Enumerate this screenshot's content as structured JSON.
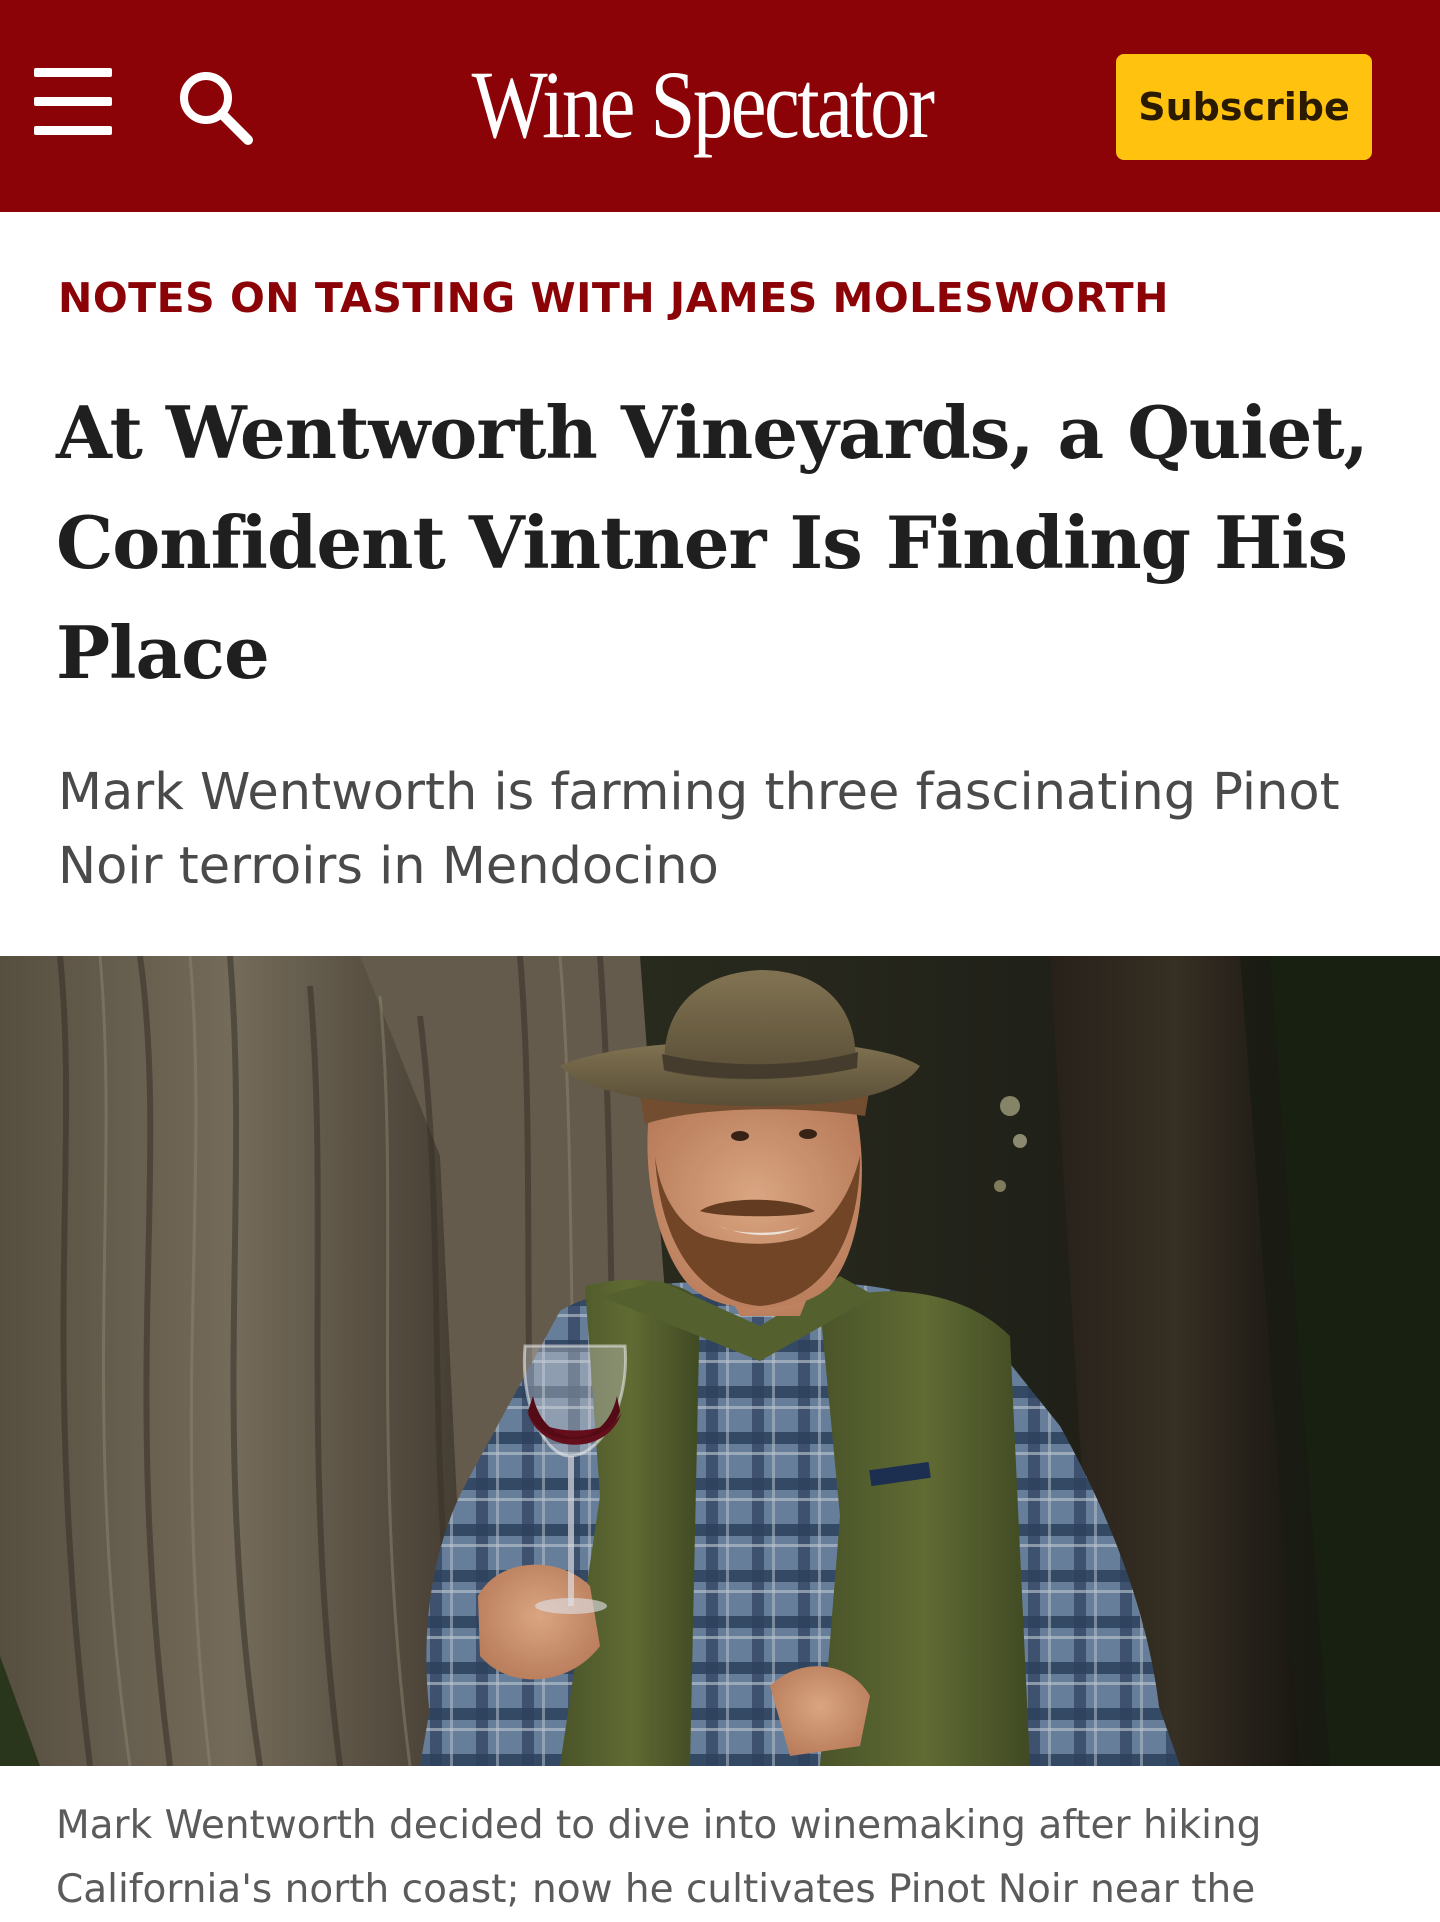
{
  "header": {
    "menu_icon": "hamburger-menu-icon",
    "search_icon": "search-icon",
    "logo_text": "Wine Spectator",
    "subscribe_label": "Subscribe",
    "background_color": "#8b0306",
    "subscribe_color": "#ffc20e"
  },
  "article": {
    "kicker": "NOTES ON TASTING WITH JAMES MOLESWORTH",
    "headline": "At Wentworth Vineyards, a Quiet, Confident Vintner Is Finding His Place",
    "dek": "Mark Wentworth is farming three fascinating Pinot Noir terroirs in Mendocino",
    "caption": "Mark Wentworth decided to dive into winemaking after hiking California's north coast; now he cultivates Pinot Noir near the"
  },
  "colors": {
    "accent": "#8b0306",
    "headline": "#1f1f1f",
    "body": "#4a4a4a"
  }
}
